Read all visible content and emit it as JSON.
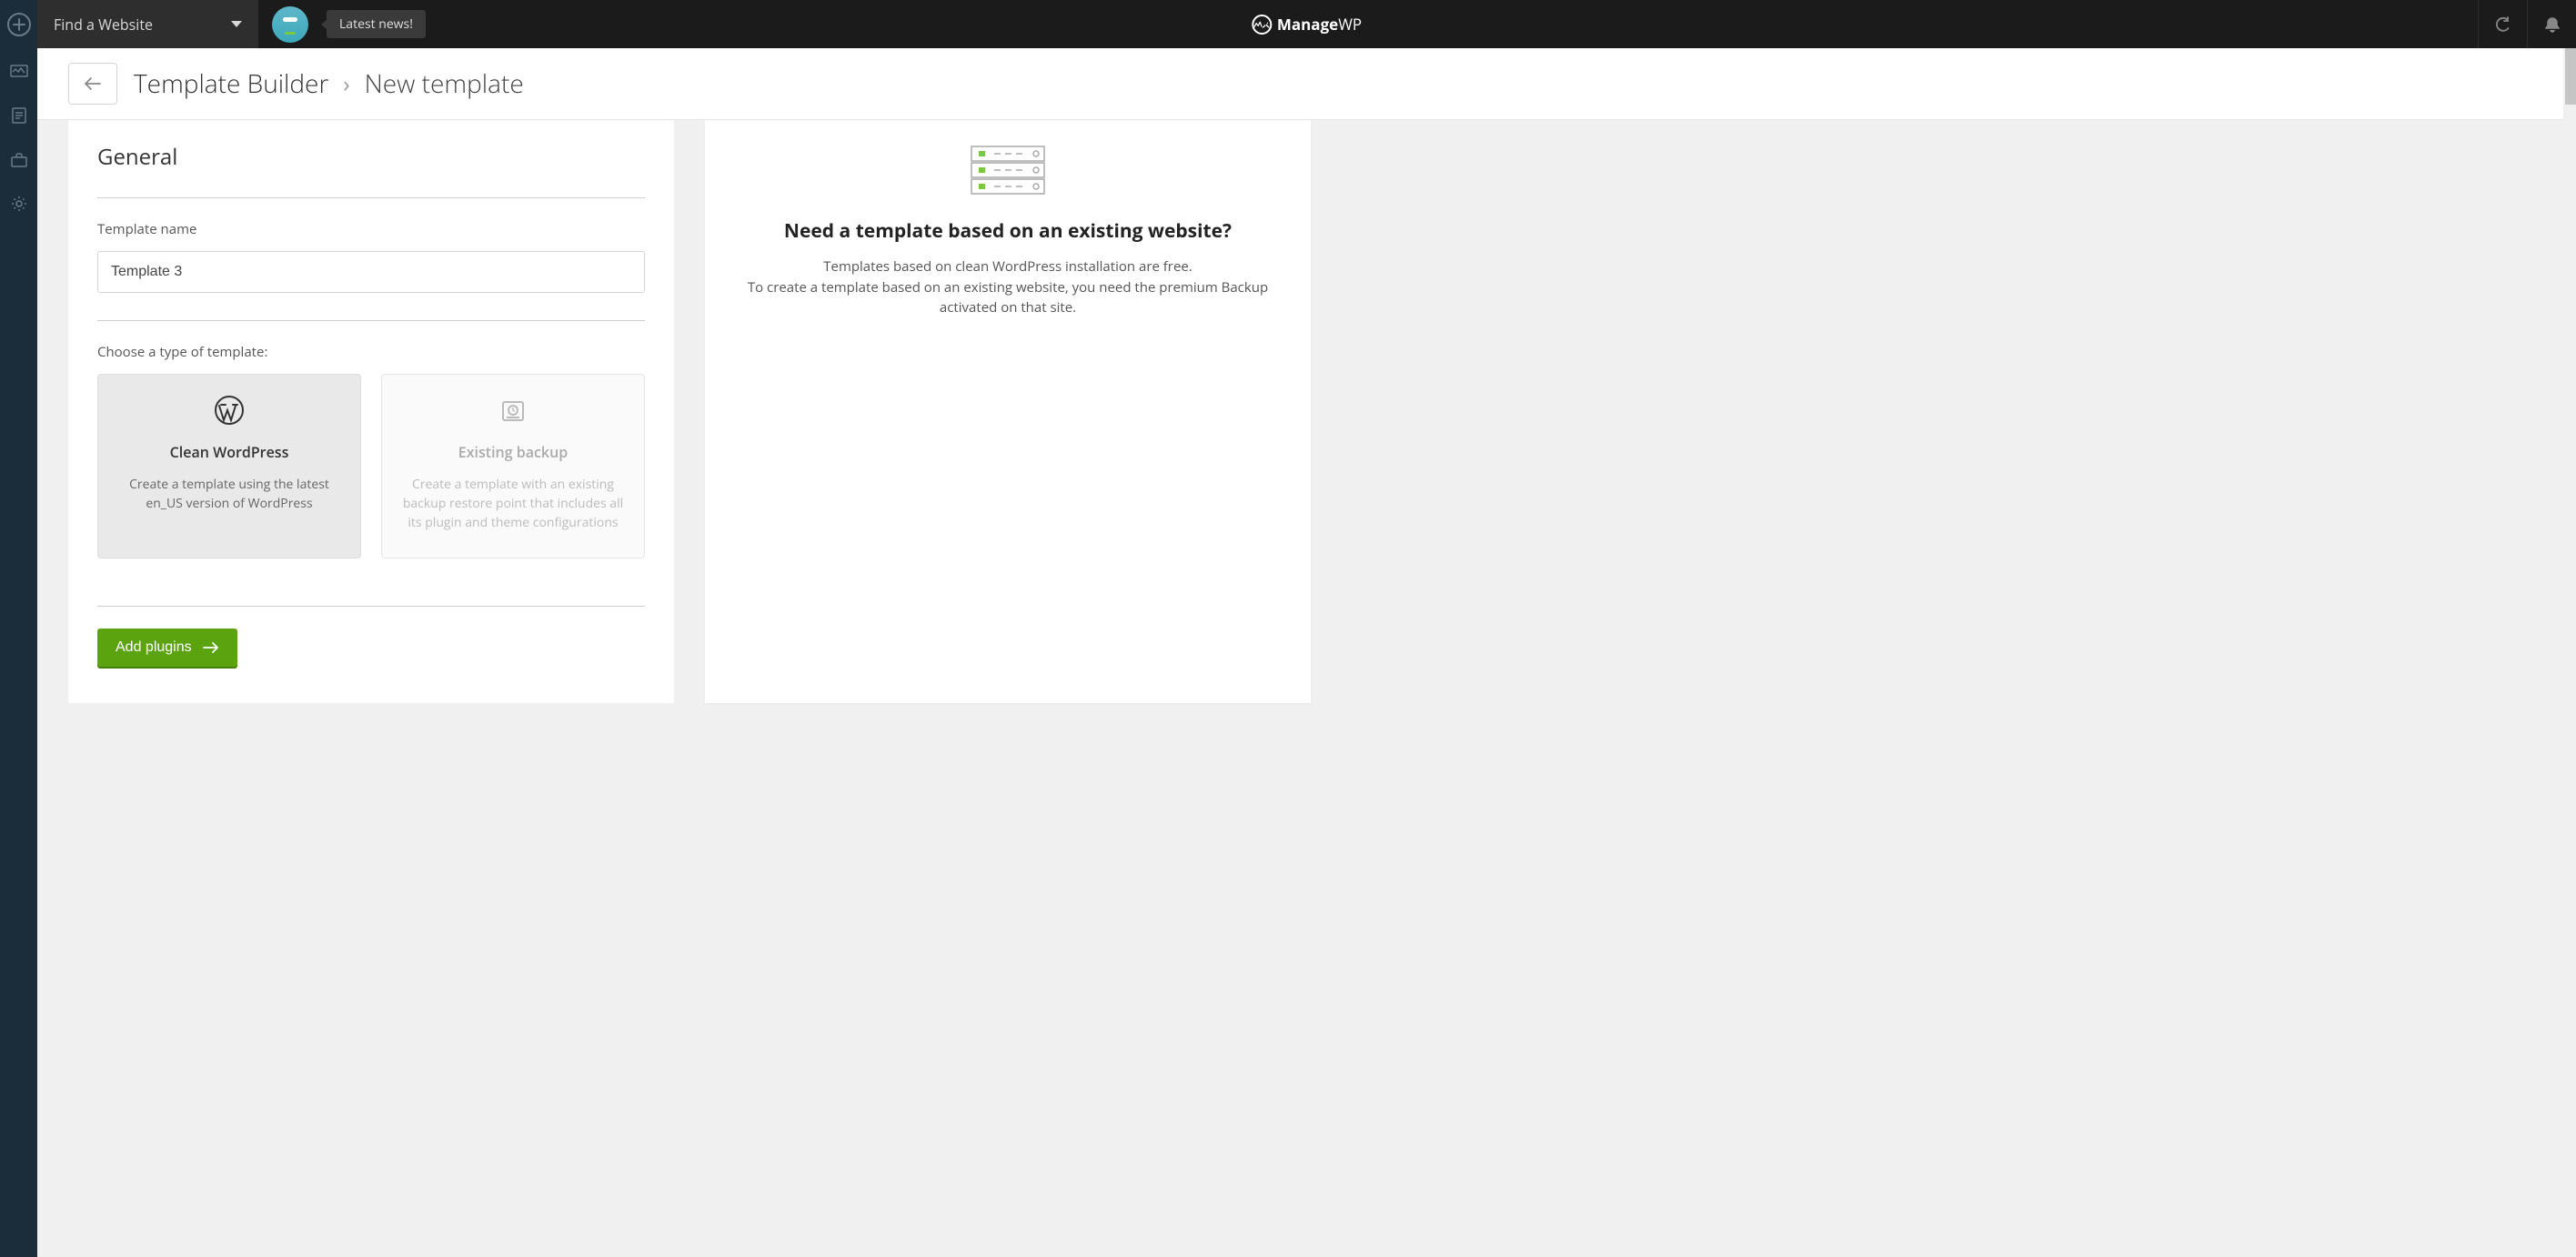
{
  "topbar": {
    "find_website": "Find a Website",
    "news_label": "Latest news!",
    "brand_bold": "Manage",
    "brand_thin": "WP"
  },
  "header": {
    "breadcrumb_root": "Template Builder",
    "breadcrumb_current": "New template"
  },
  "general": {
    "section_title": "General",
    "template_name_label": "Template name",
    "template_name_value": "Template 3",
    "choose_type_label": "Choose a type of template:",
    "option_clean": {
      "title": "Clean WordPress",
      "desc": "Create a template using the latest en_US version of WordPress"
    },
    "option_backup": {
      "title": "Existing backup",
      "desc": "Create a template with an existing backup restore point that includes all its plugin and theme configurations"
    },
    "add_plugins_label": "Add plugins"
  },
  "info": {
    "title": "Need a template based on an existing website?",
    "line1": "Templates based on clean WordPress installation are free.",
    "line2": "To create a template based on an existing website, you need the premium Backup activated on that site."
  }
}
